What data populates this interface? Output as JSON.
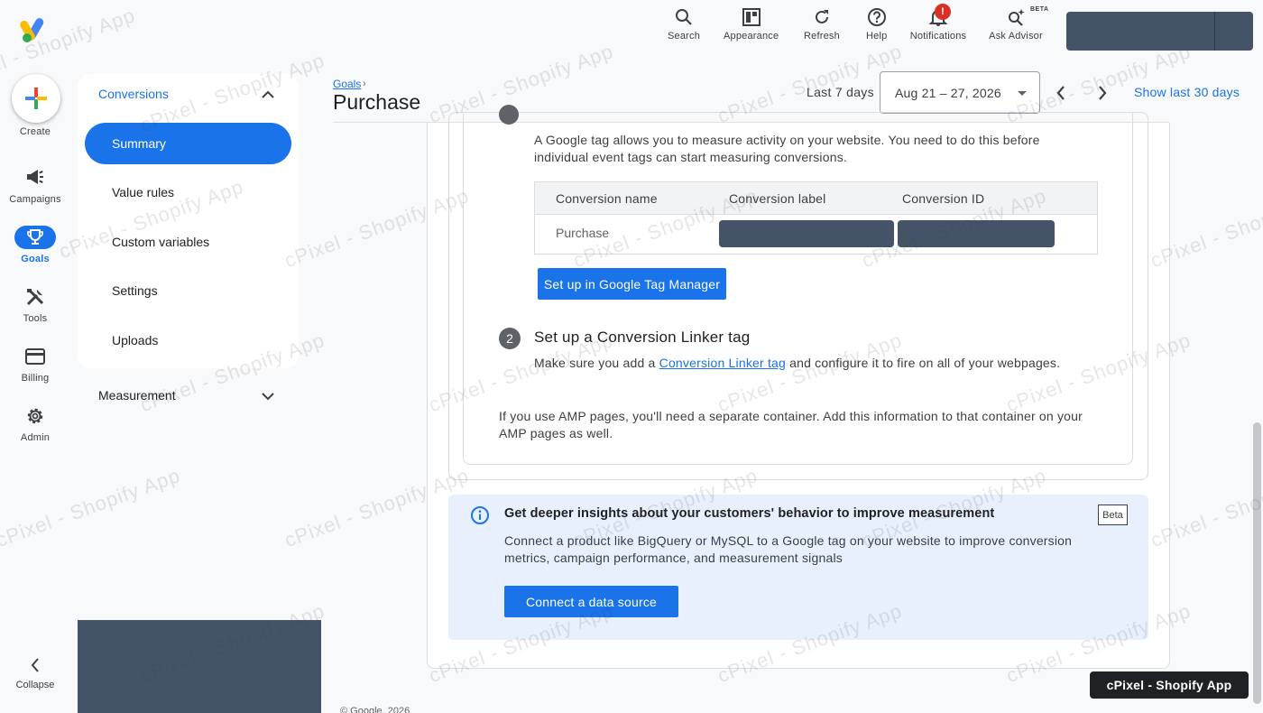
{
  "rail": {
    "create_label": "Create",
    "items": [
      {
        "label": "Campaigns",
        "icon": "megaphone-icon"
      },
      {
        "label": "Goals",
        "icon": "trophy-icon"
      },
      {
        "label": "Tools",
        "icon": "tools-icon"
      },
      {
        "label": "Billing",
        "icon": "credit-card-icon"
      },
      {
        "label": "Admin",
        "icon": "gear-icon"
      }
    ],
    "collapse_label": "Collapse"
  },
  "topbar": {
    "search": "Search",
    "appearance": "Appearance",
    "refresh": "Refresh",
    "help": "Help",
    "notifications": "Notifications",
    "notifications_badge": "!",
    "advisor": "Ask Advisor",
    "advisor_tag": "BETA"
  },
  "subnav": {
    "header": "Conversions",
    "items": [
      "Summary",
      "Value rules",
      "Custom variables",
      "Settings",
      "Uploads"
    ],
    "measurement": "Measurement"
  },
  "header": {
    "breadcrumb": "Goals",
    "title": "Purchase",
    "range_label": "Last 7 days",
    "date_range": "Aug 21 – 27, 2026",
    "show_last": "Show last 30 days"
  },
  "step1": {
    "description": "A Google tag allows you to measure activity on your website. You need to do this before individual event tags can start measuring conversions.",
    "table": {
      "headers": [
        "Conversion name",
        "Conversion label",
        "Conversion ID"
      ],
      "rows": [
        [
          "Purchase",
          "",
          ""
        ]
      ]
    },
    "button": "Set up in Google Tag Manager"
  },
  "step2": {
    "number": "2",
    "title": "Set up a Conversion Linker tag",
    "text_before": "Make sure you add a ",
    "link": "Conversion Linker tag",
    "text_after": " and configure it to fire on all of your webpages.",
    "amp_note": "If you use AMP pages, you'll need a separate container. Add this information to that container on your AMP pages as well."
  },
  "insight": {
    "title": "Get deeper insights about your customers' behavior to improve measurement",
    "beta": "Beta",
    "body": "Connect a product like BigQuery or MySQL to a Google tag on your website to improve conversion metrics, campaign performance, and measurement signals",
    "button": "Connect a data source"
  },
  "footer": "© Google, 2026",
  "toast": "cPixel - Shopify App",
  "watermark": "cPixel - Shopify App",
  "colors": {
    "primary": "#1a73e8",
    "redaction": "#455368",
    "banner": "#e8f0fe",
    "badge": "#d93025"
  }
}
